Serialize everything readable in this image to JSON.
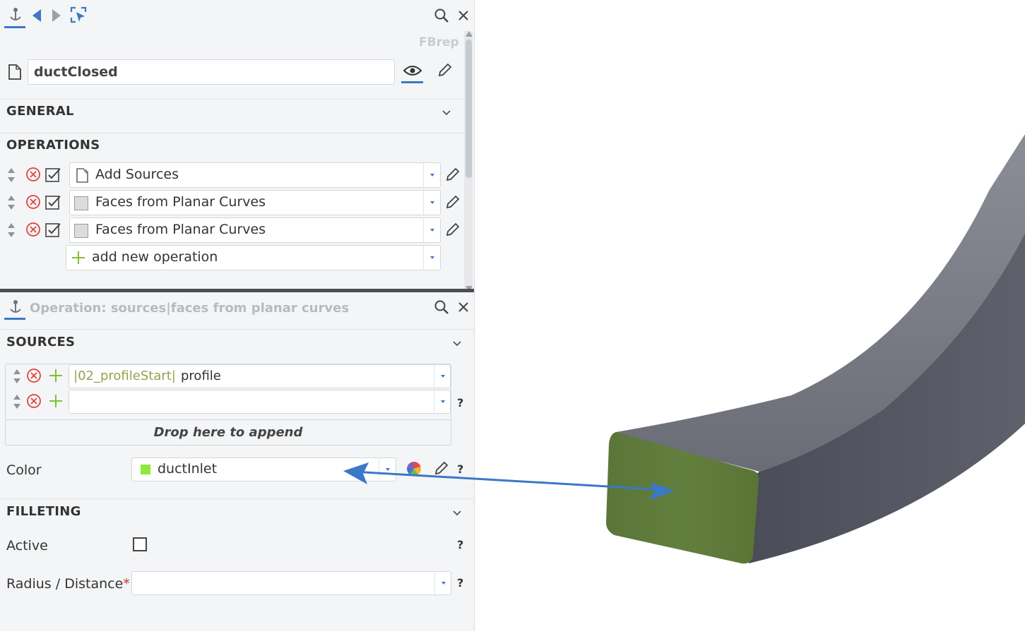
{
  "toolbar": {
    "anchor_icon": "anchor-icon",
    "back_icon": "arrow-left-icon",
    "forward_icon": "arrow-right-icon",
    "select_icon": "select-cursor-icon",
    "search_icon": "search-icon",
    "close_icon": "close-icon",
    "watermark": "FBrep"
  },
  "object": {
    "name": "ductClosed",
    "visibility_icon": "eye-icon",
    "edit_icon": "pencil-icon"
  },
  "sections": {
    "general": "GENERAL",
    "operations": "OPERATIONS",
    "sources": "SOURCES",
    "filleting": "FILLETING"
  },
  "operations": [
    {
      "label": "Add Sources",
      "icon": "add-sources-icon",
      "checked": true
    },
    {
      "label": "Faces from Planar Curves",
      "icon": "face-icon",
      "checked": true
    },
    {
      "label": "Faces from Planar Curves",
      "icon": "face-icon",
      "checked": true
    }
  ],
  "add_operation": "add new operation",
  "operation_panel": {
    "title": "Operation: sources|faces from planar curves"
  },
  "sources": [
    {
      "prefix": "|02_profileStart|",
      "value": "profile"
    },
    {
      "prefix": "",
      "value": ""
    }
  ],
  "drop_text": "Drop here to append",
  "color": {
    "label": "Color",
    "value": "ductInlet",
    "swatch": "#8fe83a"
  },
  "filleting": {
    "active_label": "Active",
    "active": false,
    "radius_label": "Radius / Distance",
    "required_marker": "*",
    "radius_value": ""
  },
  "help": "?",
  "colors": {
    "accent": "#3a78c8",
    "delete": "#e0443c",
    "add": "#7dc234",
    "duct_body": "#5c5e69",
    "duct_face": "#5f7a3c"
  }
}
